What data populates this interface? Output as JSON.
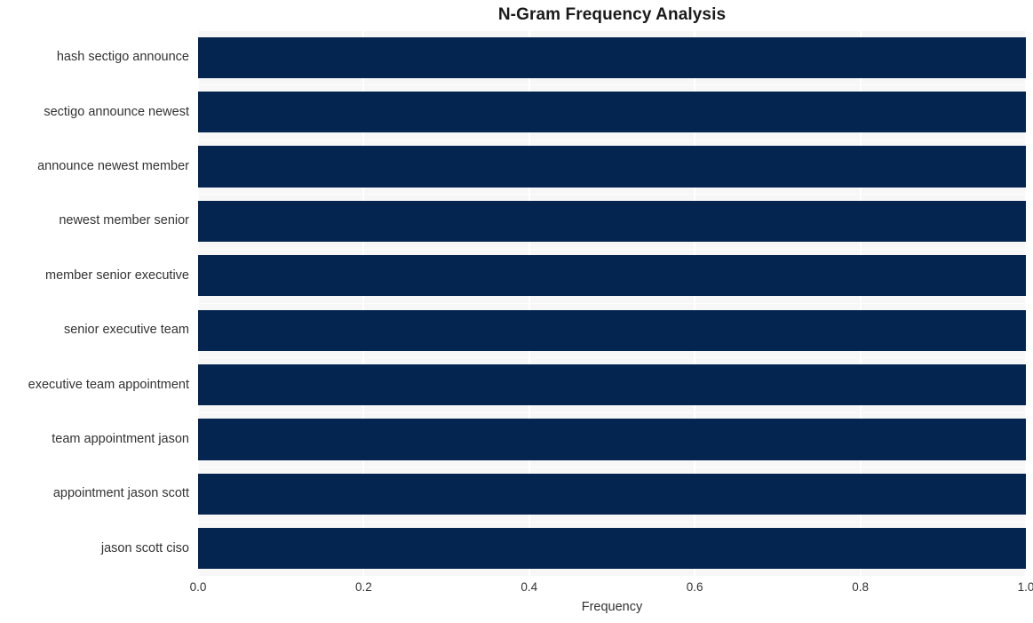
{
  "chart_data": {
    "type": "bar",
    "orientation": "horizontal",
    "title": "N-Gram Frequency Analysis",
    "xlabel": "Frequency",
    "ylabel": "",
    "xlim": [
      0.0,
      1.0
    ],
    "xticks": [
      "0.0",
      "0.2",
      "0.4",
      "0.6",
      "0.8",
      "1.0"
    ],
    "xtick_values": [
      0.0,
      0.2,
      0.4,
      0.6,
      0.8,
      1.0
    ],
    "grid": true,
    "legend": false,
    "bar_color": "#04254f",
    "plot_background": "#f7f7f7",
    "figure_background": "#ffffff",
    "gridline_color": "#ffffff",
    "categories": [
      "hash sectigo announce",
      "sectigo announce newest",
      "announce newest member",
      "newest member senior",
      "member senior executive",
      "senior executive team",
      "executive team appointment",
      "team appointment jason",
      "appointment jason scott",
      "jason scott ciso"
    ],
    "values": [
      1.0,
      1.0,
      1.0,
      1.0,
      1.0,
      1.0,
      1.0,
      1.0,
      1.0,
      1.0
    ]
  }
}
